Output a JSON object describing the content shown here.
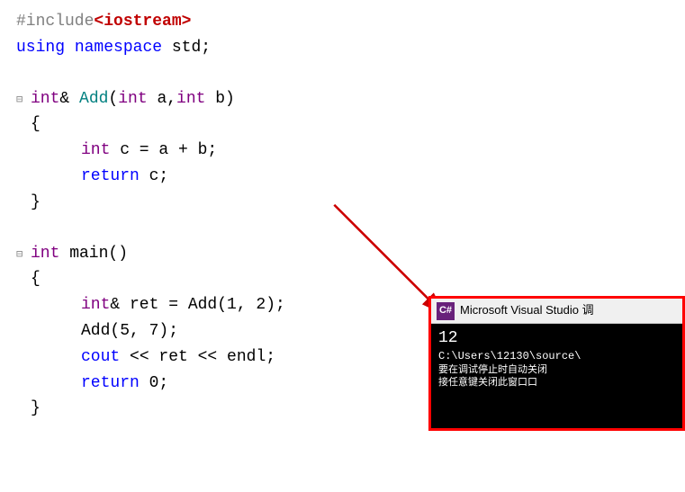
{
  "code": {
    "line1": "#include",
    "line1_lib": "<iostream>",
    "line2": "using namespace std;",
    "line4_kw": "int",
    "line4_fn": "& Add(",
    "line4_params": "int a,",
    "line4_params2": "int b)",
    "line5": "{",
    "line6_kw": "int",
    "line6_rest": " c = a + b;",
    "line7_kw": "return",
    "line7_rest": " c;",
    "line8": "}",
    "line10_kw": "int",
    "line10_fn": " main()",
    "line11": "{",
    "line12_kw": "int",
    "line12_rest": "& ret = Add(1, 2);",
    "line13": "Add(5, 7);",
    "line14_kw": "cout",
    "line14_rest": " << ret << endl;",
    "line15_kw": "return",
    "line15_rest": " 0;",
    "line16": "}"
  },
  "popup": {
    "icon_label": "C#",
    "title": "Microsoft Visual Studio 调",
    "output": "12",
    "path": "C:\\Users\\12130\\source\\",
    "info1": "要在调试停止时自动关闭",
    "info2": "接任意键关闭此窗口口"
  },
  "arrow": {
    "color": "#CC0000"
  }
}
